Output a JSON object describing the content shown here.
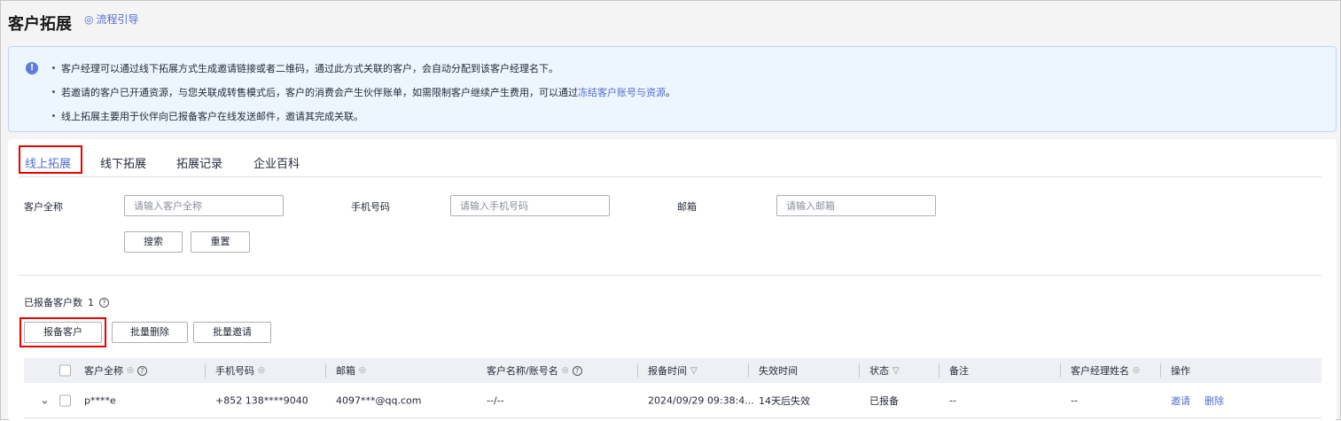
{
  "header": {
    "title": "客户拓展",
    "guide": "流程引导"
  },
  "notice": {
    "lines": [
      "客户经理可以通过线下拓展方式生成邀请链接或者二维码，通过此方式关联的客户，会自动分配到该客户经理名下。",
      "若邀请的客户已开通资源，与您关联成转售模式后，客户的消费会产生伙伴账单，如需限制客户继续产生费用，可以通过",
      "线上拓展主要用于伙伴向已报备客户在线发送邮件，邀请其完成关联。"
    ],
    "link": "冻结客户账号与资源",
    "link_suffix": "。",
    "icon": "!"
  },
  "tabs": [
    {
      "label": "线上拓展"
    },
    {
      "label": "线下拓展"
    },
    {
      "label": "拓展记录"
    },
    {
      "label": "企业百科"
    }
  ],
  "filters": {
    "name_label": "客户全称",
    "name_placeholder": "请输入客户全称",
    "phone_label": "手机号码",
    "phone_placeholder": "请输入手机号码",
    "email_label": "邮箱",
    "email_placeholder": "请输入邮箱",
    "search": "搜索",
    "reset": "重置"
  },
  "summary": {
    "label": "已报备客户数",
    "count": "1",
    "help": "?"
  },
  "actions": {
    "report": "报备客户",
    "batch_delete": "批量删除",
    "batch_invite": "批量邀请"
  },
  "table": {
    "columns": [
      "客户全称",
      "手机号码",
      "邮箱",
      "客户名称/账号名",
      "报备时间",
      "失效时间",
      "状态",
      "备注",
      "客户经理姓名",
      "操作"
    ],
    "rows": [
      {
        "name": "p****e",
        "phone": "+852 138****9040",
        "email": "4097***@qq.com",
        "account": "--/--",
        "time": "2024/09/29 09:38:4...",
        "expire": "14天后失效",
        "status": "已报备",
        "remark": "--",
        "manager": "--",
        "invite": "邀请",
        "delete": "删除"
      }
    ]
  }
}
